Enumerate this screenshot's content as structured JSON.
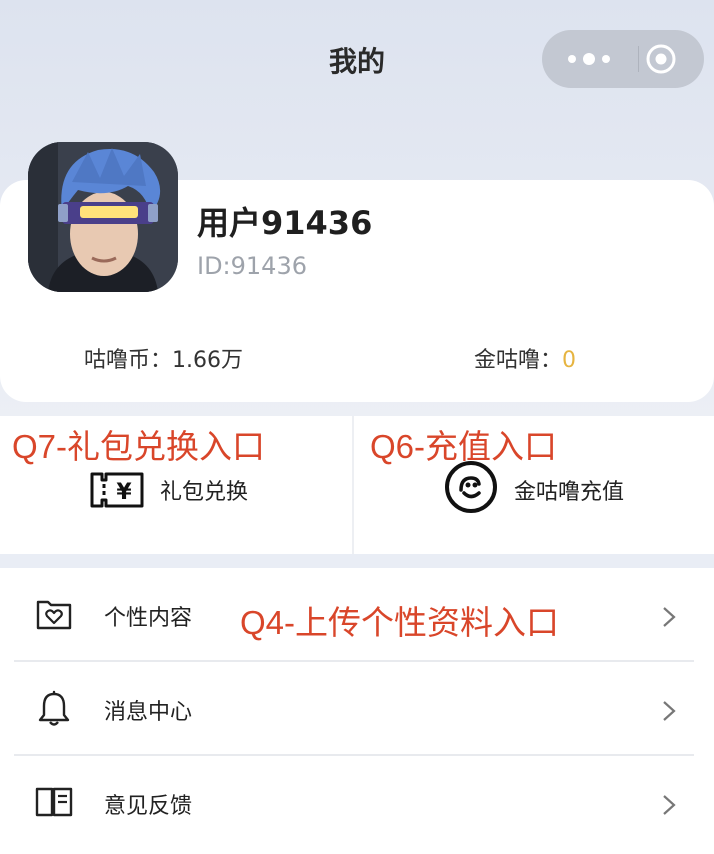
{
  "header": {
    "title": "我的"
  },
  "capsule": {
    "more_icon": "more-dots-icon",
    "close_icon": "target-circle-icon"
  },
  "user": {
    "name": "用户91436",
    "id": "ID:91436",
    "coins_label": "咕噜币：",
    "coins_value": "1.66万",
    "gold_label": "金咕噜：",
    "gold_value": "0",
    "avatar": "avatar-image"
  },
  "actions": {
    "gift": {
      "label": "礼包兑换",
      "icon": "coupon-yen-icon"
    },
    "recharge": {
      "label": "金咕噜充值",
      "icon": "smile-coin-icon"
    }
  },
  "menu": {
    "items": [
      {
        "label": "个性内容",
        "icon": "heart-folder-icon"
      },
      {
        "label": "消息中心",
        "icon": "bell-icon"
      },
      {
        "label": "意见反馈",
        "icon": "book-icon"
      }
    ]
  },
  "annotations": {
    "q7": "Q7-礼包兑换入口",
    "q6": "Q6-充值入口",
    "q4": "Q4-上传个性资料入口"
  },
  "colors": {
    "annotation": "#d9462a",
    "gold_value": "#e6b440",
    "header_bg": "#dde3ef",
    "capsule": "#c3c8d2"
  }
}
